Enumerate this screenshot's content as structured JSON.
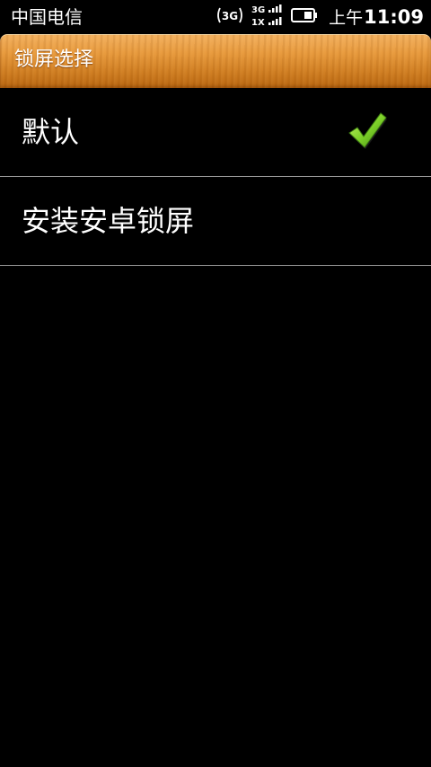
{
  "status_bar": {
    "carrier": "中国电信",
    "network_icon_label": "3G",
    "signal_3g_label": "3G",
    "signal_1x_label": "1X",
    "battery_icon": "battery-icon",
    "clock_ampm": "上午",
    "clock_time": "11:09"
  },
  "header": {
    "title": "锁屏选择"
  },
  "lock_options": [
    {
      "label": "默认",
      "checked": true
    },
    {
      "label": "安装安卓锁屏",
      "checked": false
    }
  ],
  "colors": {
    "titlebar_wood": "#e89a3d",
    "check_green": "#7fd22a",
    "divider": "#9a9a9a",
    "background": "#000000"
  }
}
